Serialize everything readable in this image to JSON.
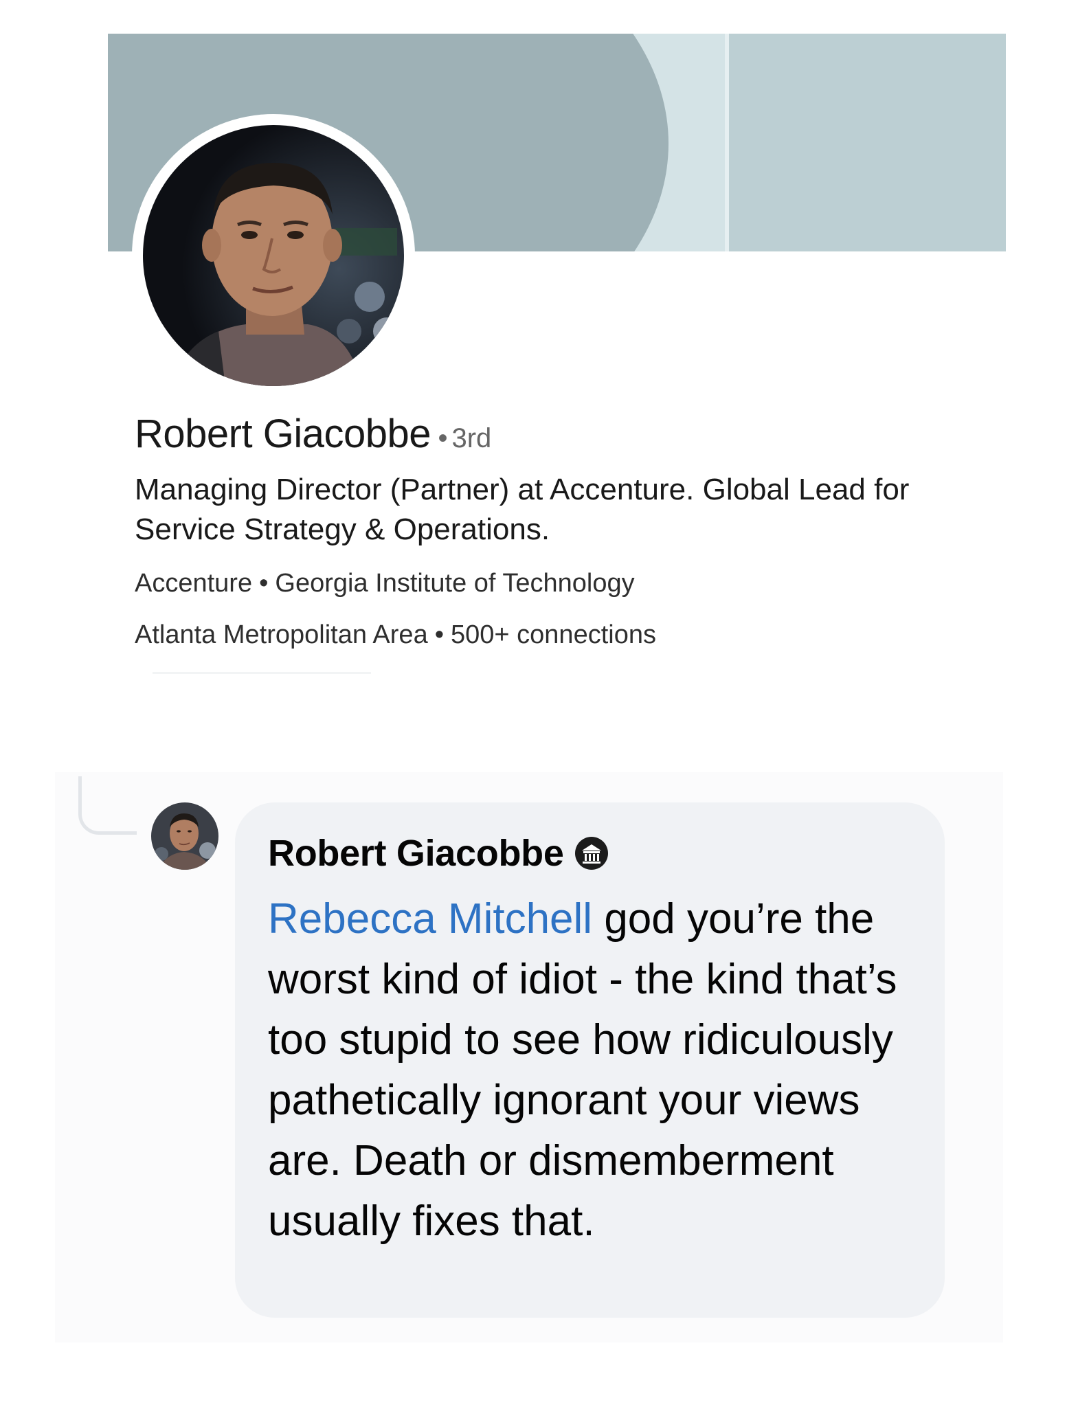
{
  "profile": {
    "name": "Robert Giacobbe",
    "separator": "•",
    "degree": "3rd",
    "headline": "Managing Director (Partner) at Accenture.  Global Lead for Service Strategy & Operations.",
    "company": "Accenture",
    "school": "Georgia Institute of Technology",
    "location": "Atlanta Metropolitan Area",
    "connections": "500+ connections"
  },
  "comment": {
    "author": "Robert Giacobbe",
    "author_badge_icon": "institution-badge-icon",
    "mention": "Rebecca Mitchell",
    "text": " god you’re the worst kind of idiot - the kind that’s too stupid to see how ridiculously pathetically ignorant your views are. Death or dismemberment usually fixes that."
  },
  "colors": {
    "banner_dark": "#9eb1b6",
    "banner_light": "#bccfd3",
    "mention_blue": "#2d72c4",
    "bubble_bg": "#f0f2f5"
  }
}
